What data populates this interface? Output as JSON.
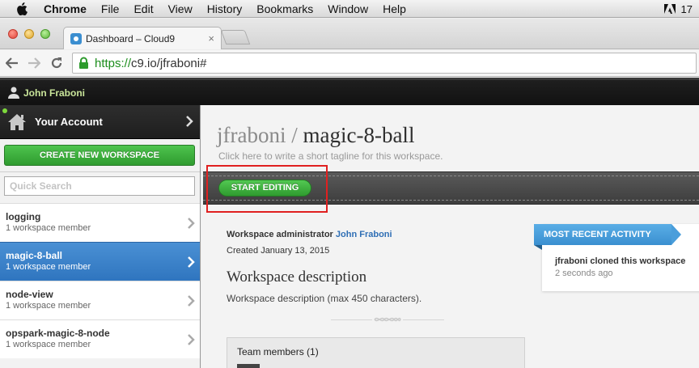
{
  "menubar": {
    "app": "Chrome",
    "items": [
      "File",
      "Edit",
      "View",
      "History",
      "Bookmarks",
      "Window",
      "Help"
    ],
    "right_badge": "17"
  },
  "browser": {
    "tab_title": "Dashboard – Cloud9",
    "tab_close": "×",
    "url_scheme": "https://",
    "url_rest": "c9.io/jfraboni#"
  },
  "app": {
    "username": "John Fraboni"
  },
  "sidebar": {
    "account_label": "Your Account",
    "create_label": "CREATE NEW WORKSPACE",
    "search_placeholder": "Quick Search",
    "workspaces": [
      {
        "name": "logging",
        "members": "1 workspace member"
      },
      {
        "name": "magic-8-ball",
        "members": "1 workspace member"
      },
      {
        "name": "node-view",
        "members": "1 workspace member"
      },
      {
        "name": "opspark-magic-8-node",
        "members": "1 workspace member"
      }
    ]
  },
  "workspace": {
    "owner": "jfraboni",
    "separator": " / ",
    "name": "magic-8-ball",
    "tagline": "Click here to write a short tagline for this workspace.",
    "start_label": "START EDITING",
    "admin_label": "Workspace administrator",
    "admin_name": "John Fraboni",
    "created": "Created January 13, 2015",
    "description_title": "Workspace description",
    "description_text": "Workspace description (max 450 characters).",
    "team_label": "Team members (1)"
  },
  "activity": {
    "title": "MOST RECENT ACTIVITY",
    "text": "jfraboni cloned this workspace",
    "time": "2 seconds ago"
  },
  "colors": {
    "accent_green": "#2f9b2f",
    "selection_blue": "#2f75bf",
    "highlight_red": "#e02020"
  }
}
